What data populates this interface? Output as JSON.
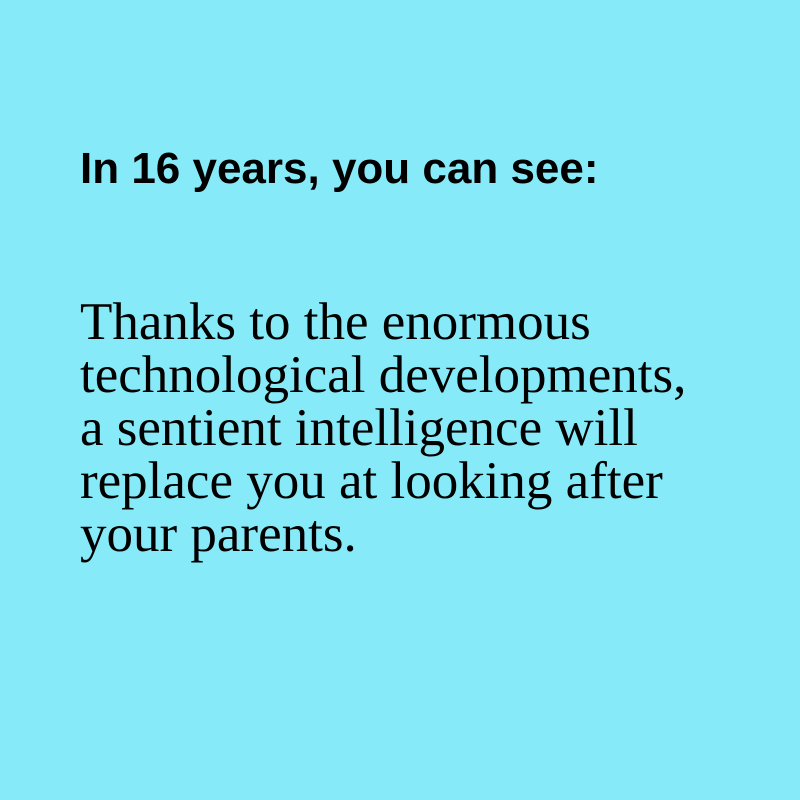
{
  "card": {
    "background_color": "#86eaf8",
    "text_color": "#000000",
    "heading": "In 16 years, you can see:",
    "body": "Thanks to the enormous technological developments, a sentient intelligence will replace you at looking after your parents."
  }
}
